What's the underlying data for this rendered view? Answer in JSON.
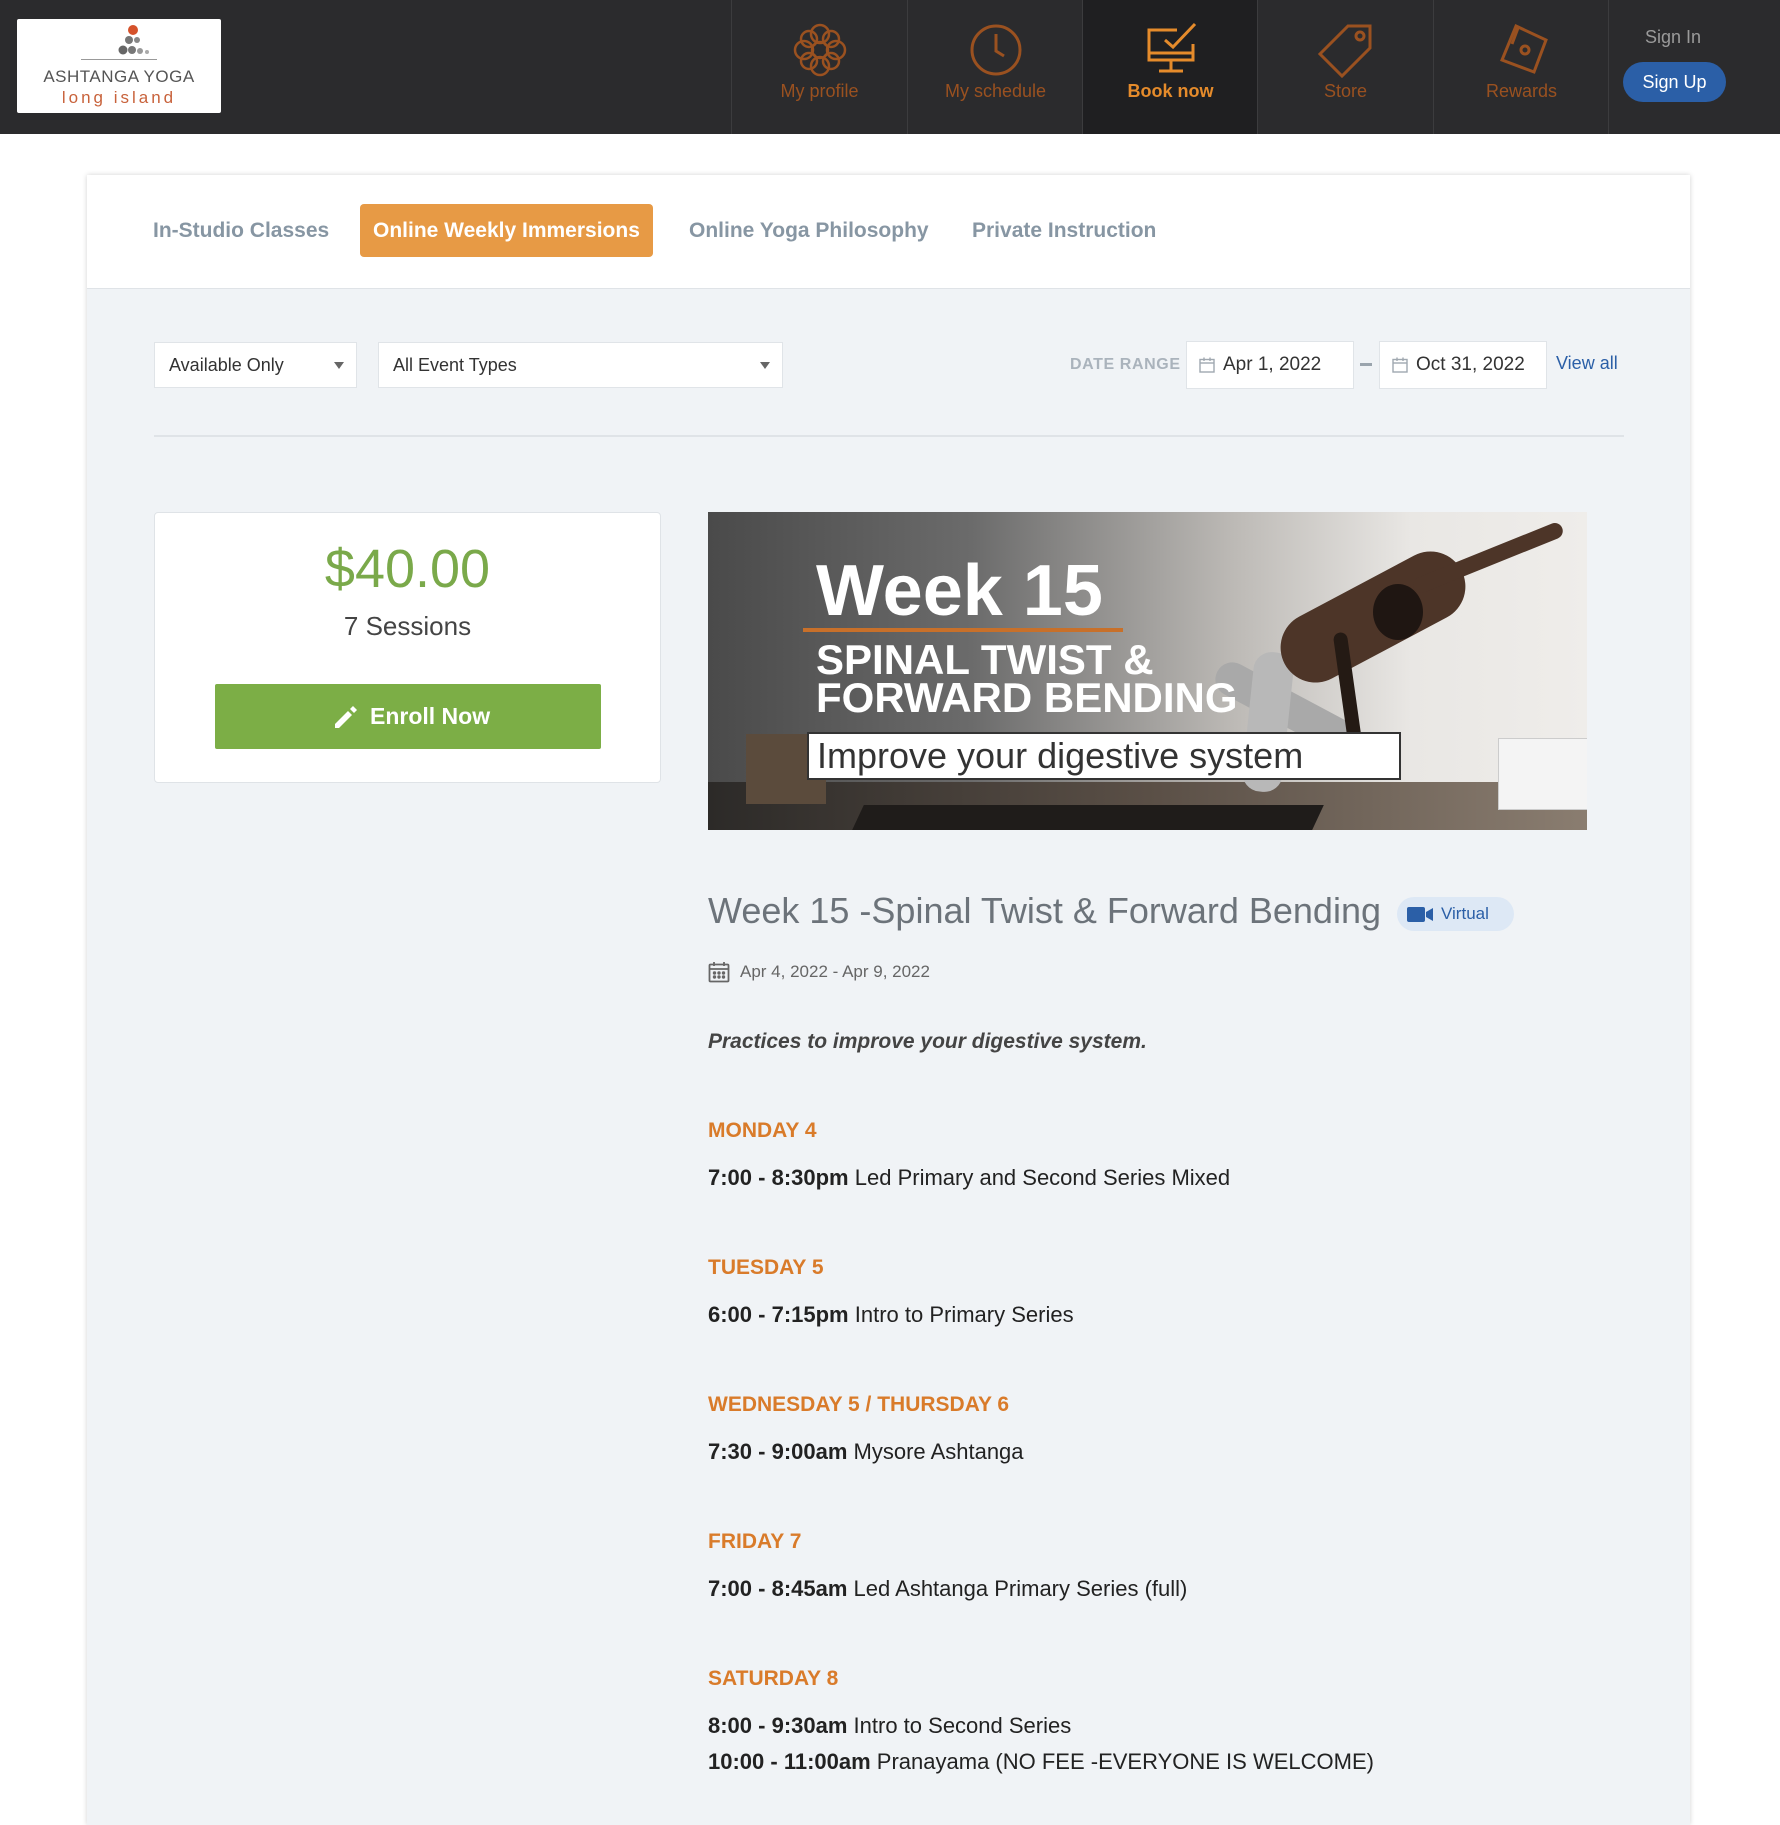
{
  "header": {
    "logo_line1": "ASHTANGA YOGA",
    "logo_line2": "long island",
    "nav": [
      {
        "label": "My profile",
        "icon": "profile-flower-icon",
        "active": false
      },
      {
        "label": "My schedule",
        "icon": "clock-icon",
        "active": false
      },
      {
        "label": "Book now",
        "icon": "monitor-check-icon",
        "active": true
      },
      {
        "label": "Store",
        "icon": "tag-icon",
        "active": false
      },
      {
        "label": "Rewards",
        "icon": "ticket-icon",
        "active": false
      }
    ],
    "sign_in": "Sign In",
    "sign_up": "Sign Up"
  },
  "tabs": [
    {
      "label": "In-Studio Classes",
      "active": false
    },
    {
      "label": "Online Weekly Immersions",
      "active": true
    },
    {
      "label": "Online Yoga Philosophy",
      "active": false
    },
    {
      "label": "Private Instruction",
      "active": false
    }
  ],
  "filters": {
    "availability": "Available Only",
    "event_type": "All Event Types",
    "date_range_label": "DATE RANGE",
    "start_date": "Apr 1, 2022",
    "end_date": "Oct 31, 2022",
    "view_all": "View all"
  },
  "pricing": {
    "price": "$40.00",
    "sessions": "7 Sessions",
    "enroll_label": "Enroll Now"
  },
  "banner": {
    "week": "Week 15",
    "line1": "SPINAL TWIST &",
    "line2": "FORWARD BENDING",
    "tagline": "Improve your digestive system"
  },
  "event": {
    "title": "Week 15 -Spinal Twist & Forward Bending",
    "badge": "Virtual",
    "dates": "Apr 4, 2022 - Apr 9, 2022",
    "description": "Practices to improve your digestive system."
  },
  "schedule": [
    {
      "day": "MONDAY 4",
      "slots": [
        {
          "time": "7:00 - 8:30pm",
          "name": "Led Primary and Second Series Mixed"
        }
      ]
    },
    {
      "day": "TUESDAY 5",
      "slots": [
        {
          "time": "6:00 - 7:15pm",
          "name": "Intro to Primary Series"
        }
      ]
    },
    {
      "day": "WEDNESDAY 5 / THURSDAY 6",
      "slots": [
        {
          "time": "7:30 - 9:00am",
          "name": "Mysore Ashtanga"
        }
      ]
    },
    {
      "day": "FRIDAY 7",
      "slots": [
        {
          "time": "7:00 - 8:45am",
          "name": "Led Ashtanga Primary Series (full)"
        }
      ]
    },
    {
      "day": "SATURDAY 8",
      "slots": [
        {
          "time": "8:00 - 9:30am",
          "name": "Intro to Second Series"
        },
        {
          "time": "10:00 - 11:00am",
          "name": "Pranayama (NO FEE -EVERYONE IS WELCOME)"
        }
      ]
    }
  ],
  "colors": {
    "topbar": "#2b2b2d",
    "accent_orange": "#e79a45",
    "nav_active": "#e58b2b",
    "price_green": "#7aa94a",
    "enroll_green": "#7cae46",
    "link_blue": "#2b5fa7",
    "day_orange": "#d97b2a"
  }
}
